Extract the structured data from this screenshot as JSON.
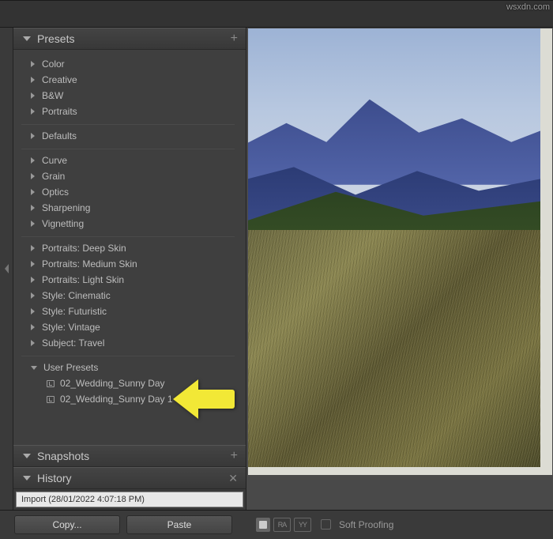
{
  "watermark": "wsxdn.com",
  "panels": {
    "presets": {
      "title": "Presets"
    },
    "snapshots": {
      "title": "Snapshots"
    },
    "history": {
      "title": "History"
    }
  },
  "preset_groups": [
    {
      "items": [
        {
          "label": "Color",
          "expanded": false
        },
        {
          "label": "Creative",
          "expanded": false
        },
        {
          "label": "B&W",
          "expanded": false
        },
        {
          "label": "Portraits",
          "expanded": false
        }
      ]
    },
    {
      "items": [
        {
          "label": "Defaults",
          "expanded": false
        }
      ]
    },
    {
      "items": [
        {
          "label": "Curve",
          "expanded": false
        },
        {
          "label": "Grain",
          "expanded": false
        },
        {
          "label": "Optics",
          "expanded": false
        },
        {
          "label": "Sharpening",
          "expanded": false
        },
        {
          "label": "Vignetting",
          "expanded": false
        }
      ]
    },
    {
      "items": [
        {
          "label": "Portraits: Deep Skin",
          "expanded": false
        },
        {
          "label": "Portraits: Medium Skin",
          "expanded": false
        },
        {
          "label": "Portraits: Light Skin",
          "expanded": false
        },
        {
          "label": "Style: Cinematic",
          "expanded": false
        },
        {
          "label": "Style: Futuristic",
          "expanded": false
        },
        {
          "label": "Style: Vintage",
          "expanded": false
        },
        {
          "label": "Subject: Travel",
          "expanded": false
        }
      ]
    },
    {
      "items": [
        {
          "label": "User Presets",
          "expanded": true,
          "children": [
            {
              "label": "02_Wedding_Sunny Day"
            },
            {
              "label": "02_Wedding_Sunny Day 1"
            }
          ]
        }
      ]
    }
  ],
  "history_items": [
    "Import (28/01/2022 4:07:18 PM)"
  ],
  "buttons": {
    "copy": "Copy...",
    "paste": "Paste"
  },
  "toolbar": {
    "compare_labels": [
      "RA",
      "YY"
    ],
    "soft_proofing": "Soft Proofing"
  },
  "annotation": {
    "arrow_color": "#f2e836"
  }
}
